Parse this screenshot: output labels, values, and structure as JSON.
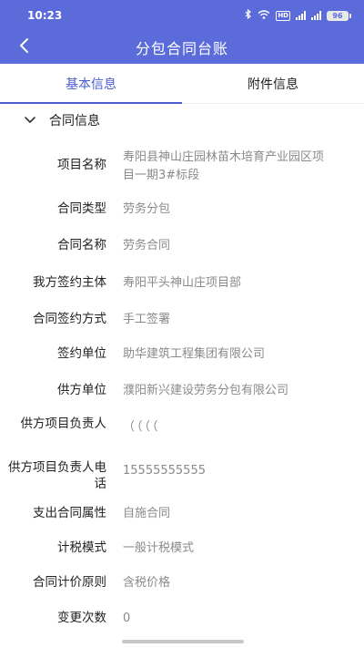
{
  "status": {
    "time": "10:23",
    "battery": "96",
    "hd_label": "HD"
  },
  "header": {
    "title": "分包合同台账"
  },
  "tabs": [
    {
      "label": "基本信息",
      "active": true
    },
    {
      "label": "附件信息",
      "active": false
    }
  ],
  "section": {
    "title": "合同信息"
  },
  "fields": [
    {
      "label": "项目名称",
      "value": "寿阳县神山庄园林苗木培育产业园区项目一期3#标段"
    },
    {
      "label": "合同类型",
      "value": "劳务分包"
    },
    {
      "label": "合同名称",
      "value": "劳务合同"
    },
    {
      "label": "我方签约主体",
      "value": "寿阳平头神山庄项目部"
    },
    {
      "label": "合同签约方式",
      "value": "手工签署"
    },
    {
      "label": "签约单位",
      "value": "助华建筑工程集团有限公司"
    },
    {
      "label": "供方单位",
      "value": "濮阳新兴建设劳务分包有限公司"
    },
    {
      "label": "供方项目负责人",
      "value": "（（（（"
    },
    {
      "label": "供方项目负责人电话",
      "value": "15555555555"
    },
    {
      "label": "支出合同属性",
      "value": "自施合同"
    },
    {
      "label": "计税模式",
      "value": "一般计税模式"
    },
    {
      "label": "合同计价原则",
      "value": "含税价格"
    },
    {
      "label": "变更次数",
      "value": "0"
    }
  ],
  "colors": {
    "primary": "#5b6bd9",
    "tab_active": "#4a5bd0",
    "value_text": "#8a8a8a"
  }
}
